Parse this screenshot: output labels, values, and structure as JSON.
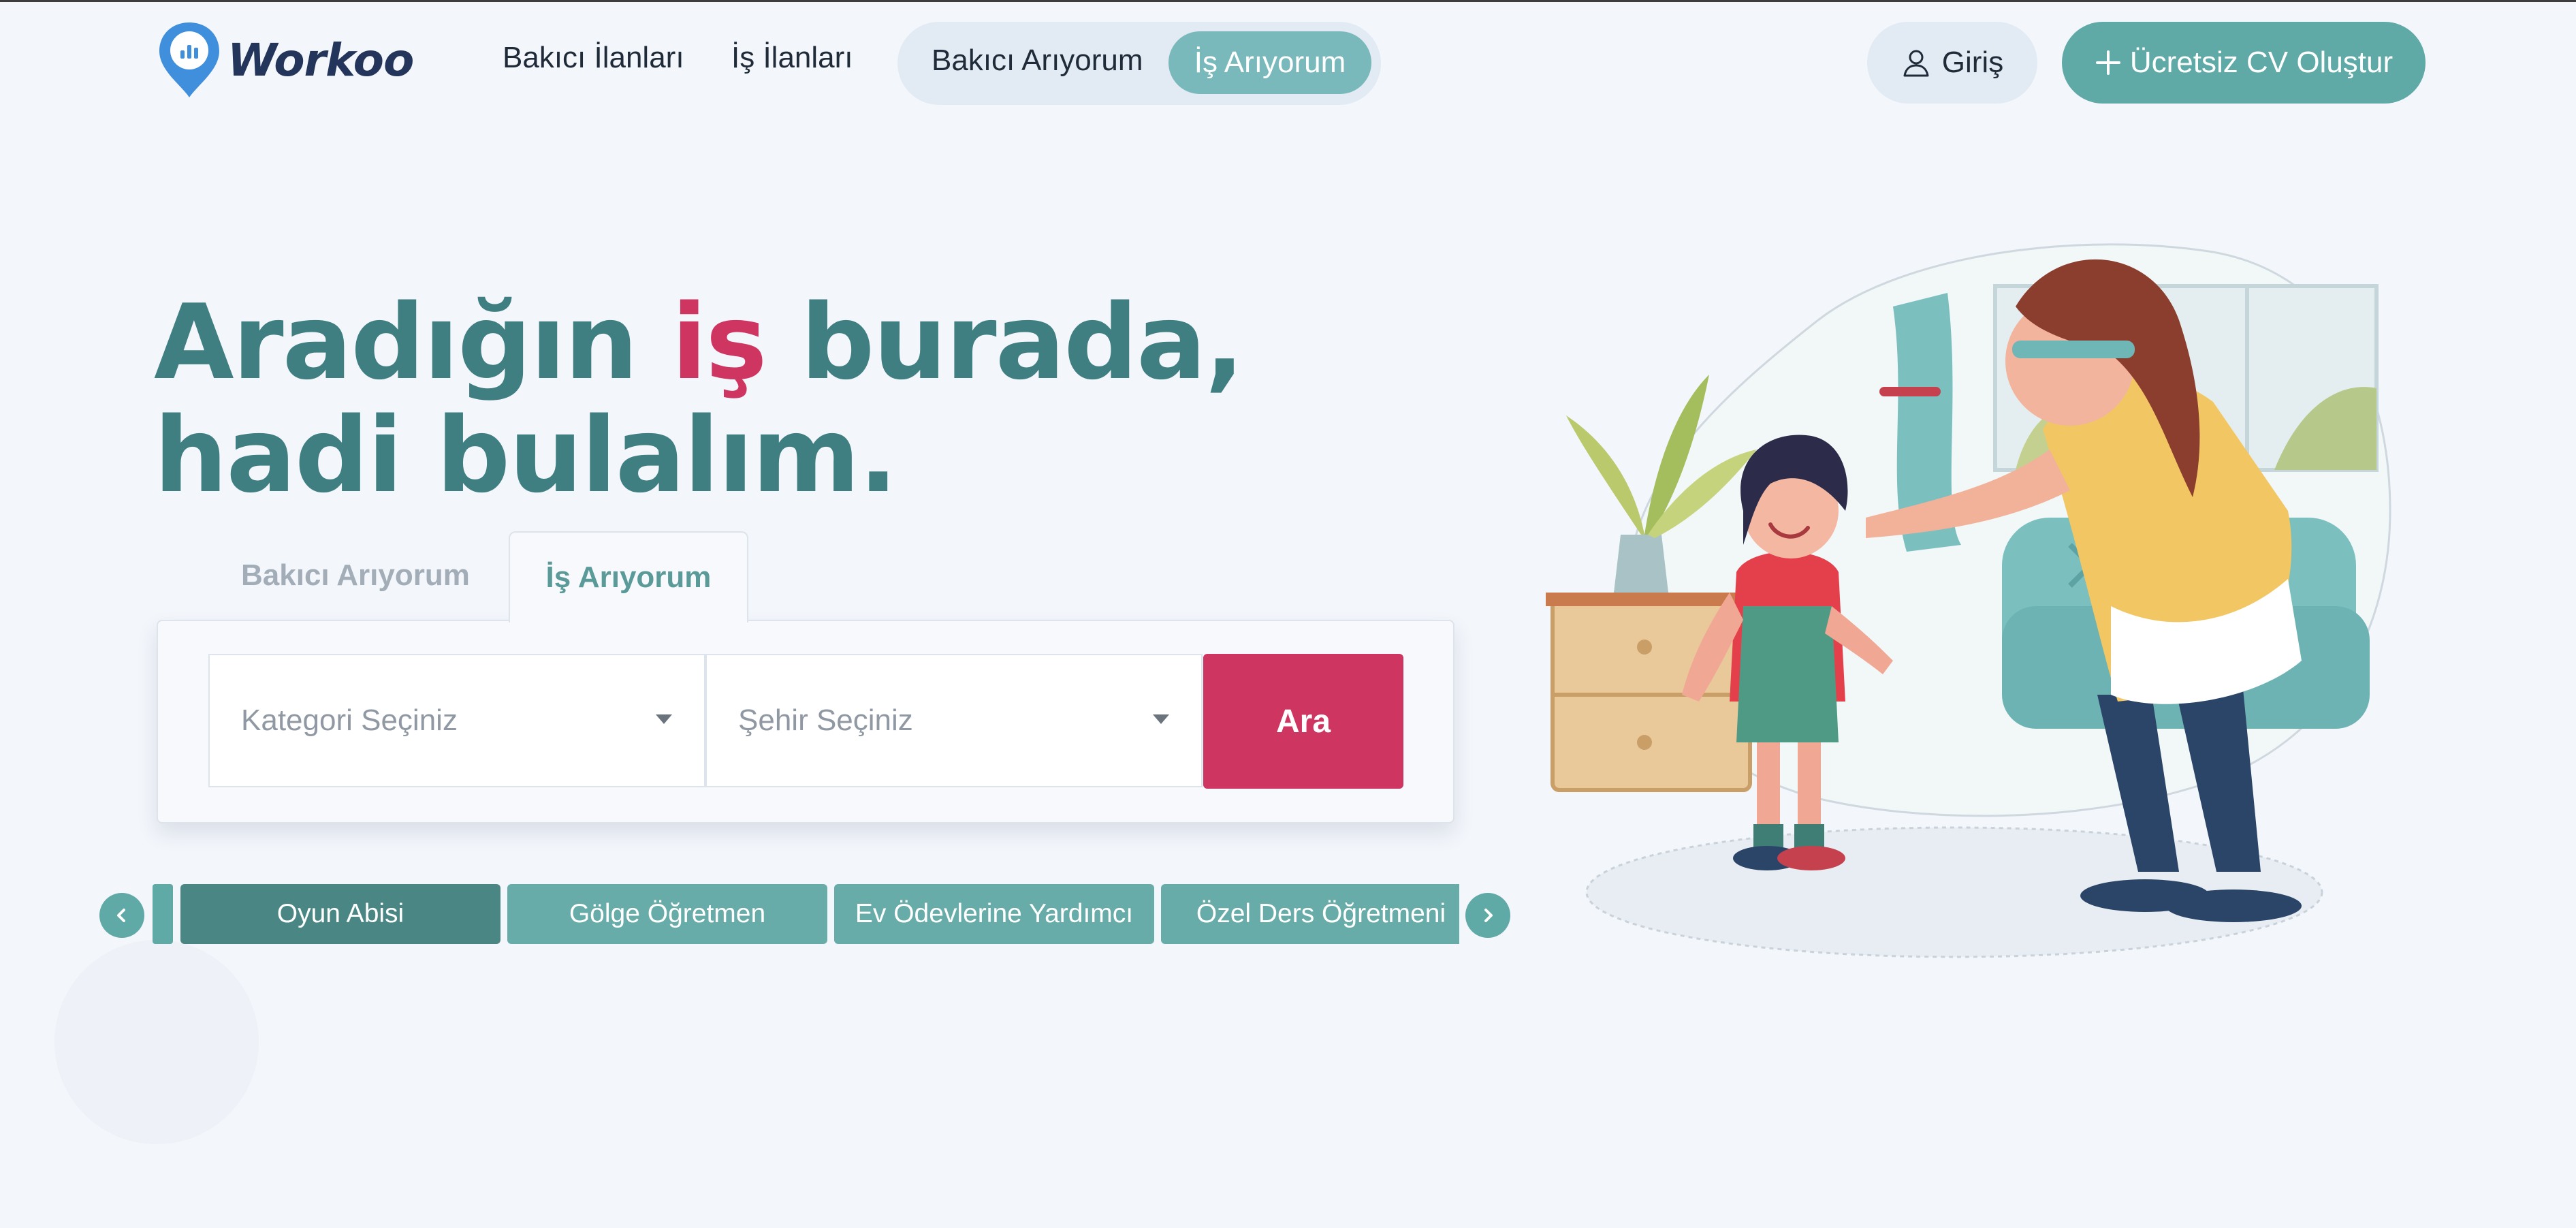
{
  "brand": {
    "name": "Workoo"
  },
  "nav": {
    "links": [
      "Bakıcı İlanları",
      "İş İlanları"
    ],
    "toggle": {
      "option_a": "Bakıcı Arıyorum",
      "option_b": "İş Arıyorum",
      "selected": "İş Arıyorum"
    },
    "login_label": "Giriş",
    "cta_label": "Ücretsiz CV Oluştur"
  },
  "hero": {
    "title_part1": "Aradığın",
    "title_accent": "iş",
    "title_part2": "burada,",
    "title_line2": "hadi bulalım."
  },
  "search": {
    "tabs": [
      "Bakıcı Arıyorum",
      "İş Arıyorum"
    ],
    "active_tab": "İş Arıyorum",
    "category_placeholder": "Kategori Seçiniz",
    "city_placeholder": "Şehir Seçiniz",
    "button_label": "Ara"
  },
  "categories": {
    "items": [
      "Oyun Abisi",
      "Gölge Öğretmen",
      "Ev Ödevlerine Yardımcı",
      "Özel Ders Öğretmeni"
    ],
    "active": "Oyun Abisi"
  },
  "colors": {
    "teal": "#3f7f82",
    "accent": "#cf3561",
    "button_teal": "#5fa9a6",
    "background": "#f3f6fb"
  },
  "icons": [
    "location-pin-logo-icon",
    "user-icon",
    "plus-icon",
    "chevron-down-icon",
    "chevron-left-icon",
    "chevron-right-icon"
  ]
}
